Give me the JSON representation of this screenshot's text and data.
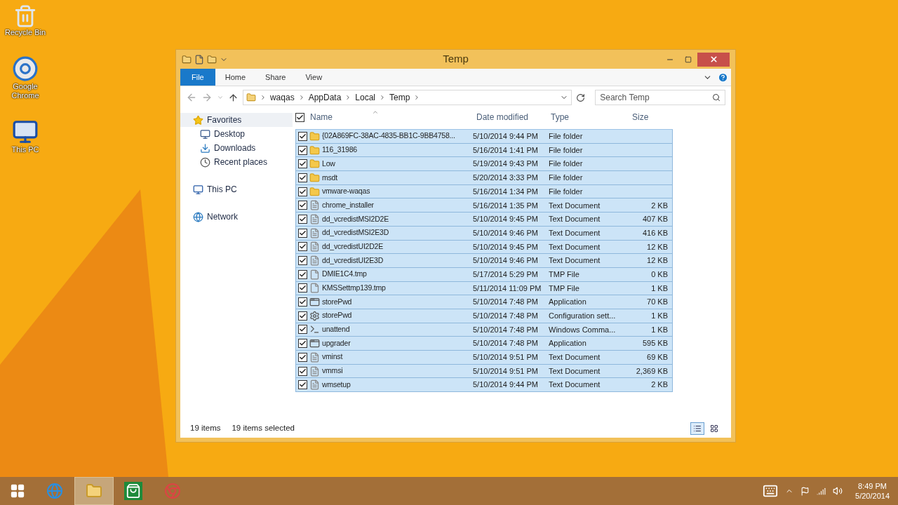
{
  "desktop_icons": [
    {
      "label": "Recycle Bin",
      "kind": "bin"
    },
    {
      "label": "Google Chrome",
      "kind": "browser"
    },
    {
      "label": "This PC",
      "kind": "pc"
    }
  ],
  "window": {
    "title": "Temp",
    "ribbon_tabs": [
      {
        "label": "File",
        "kind": "file",
        "selected": false
      },
      {
        "label": "Home",
        "kind": "tab",
        "selected": false
      },
      {
        "label": "Share",
        "kind": "tab",
        "selected": false
      },
      {
        "label": "View",
        "kind": "tab",
        "selected": false
      }
    ],
    "address": {
      "breadcrumbs": [
        "waqas",
        "AppData",
        "Local",
        "Temp"
      ]
    },
    "search": {
      "placeholder": "Search Temp"
    },
    "nav": [
      {
        "label": "Favorites",
        "kind": "star",
        "selected": true,
        "children": [
          {
            "label": "Desktop",
            "kind": "desktop",
            "selected": false
          },
          {
            "label": "Downloads",
            "kind": "downloads",
            "selected": false
          },
          {
            "label": "Recent places",
            "kind": "recent",
            "selected": false
          }
        ]
      },
      {
        "label": "This PC",
        "kind": "pc",
        "selected": false
      },
      {
        "label": "Network",
        "kind": "network",
        "selected": false
      }
    ],
    "select_all_checked": true,
    "columns": [
      {
        "label": "Name",
        "sorted": true
      },
      {
        "label": "Date modified",
        "sorted": false
      },
      {
        "label": "Type",
        "sorted": false
      },
      {
        "label": "Size",
        "sorted": false
      }
    ],
    "rows": [
      {
        "name": "{02A869FC-38AC-4835-BB1C-9BB4758...",
        "date": "5/10/2014 9:44 PM",
        "type": "File folder",
        "size": "",
        "kind": "folder",
        "selected": true
      },
      {
        "name": "116_31986",
        "date": "5/16/2014 1:41 PM",
        "type": "File folder",
        "size": "",
        "kind": "folder",
        "selected": true
      },
      {
        "name": "Low",
        "date": "5/19/2014 9:43 PM",
        "type": "File folder",
        "size": "",
        "kind": "folder",
        "selected": true
      },
      {
        "name": "msdt",
        "date": "5/20/2014 3:33 PM",
        "type": "File folder",
        "size": "",
        "kind": "folder",
        "selected": true
      },
      {
        "name": "vmware-waqas",
        "date": "5/16/2014 1:34 PM",
        "type": "File folder",
        "size": "",
        "kind": "folder",
        "selected": true
      },
      {
        "name": "chrome_installer",
        "date": "5/16/2014 1:35 PM",
        "type": "Text Document",
        "size": "2 KB",
        "kind": "text",
        "selected": true
      },
      {
        "name": "dd_vcredistMSI2D2E",
        "date": "5/10/2014 9:45 PM",
        "type": "Text Document",
        "size": "407 KB",
        "kind": "text",
        "selected": true
      },
      {
        "name": "dd_vcredistMSI2E3D",
        "date": "5/10/2014 9:46 PM",
        "type": "Text Document",
        "size": "416 KB",
        "kind": "text",
        "selected": true
      },
      {
        "name": "dd_vcredistUI2D2E",
        "date": "5/10/2014 9:45 PM",
        "type": "Text Document",
        "size": "12 KB",
        "kind": "text",
        "selected": true
      },
      {
        "name": "dd_vcredistUI2E3D",
        "date": "5/10/2014 9:46 PM",
        "type": "Text Document",
        "size": "12 KB",
        "kind": "text",
        "selected": true
      },
      {
        "name": "DMIE1C4.tmp",
        "date": "5/17/2014 5:29 PM",
        "type": "TMP File",
        "size": "0 KB",
        "kind": "blank",
        "selected": true
      },
      {
        "name": "KMSSettmp139.tmp",
        "date": "5/11/2014 11:09 PM",
        "type": "TMP File",
        "size": "1 KB",
        "kind": "blank",
        "selected": true
      },
      {
        "name": "storePwd",
        "date": "5/10/2014 7:48 PM",
        "type": "Application",
        "size": "70 KB",
        "kind": "app",
        "selected": true
      },
      {
        "name": "storePwd",
        "date": "5/10/2014 7:48 PM",
        "type": "Configuration sett...",
        "size": "1 KB",
        "kind": "config",
        "selected": true
      },
      {
        "name": "unattend",
        "date": "5/10/2014 7:48 PM",
        "type": "Windows Comma...",
        "size": "1 KB",
        "kind": "cmd",
        "selected": true
      },
      {
        "name": "upgrader",
        "date": "5/10/2014 7:48 PM",
        "type": "Application",
        "size": "595 KB",
        "kind": "app",
        "selected": true
      },
      {
        "name": "vminst",
        "date": "5/10/2014 9:51 PM",
        "type": "Text Document",
        "size": "69 KB",
        "kind": "text",
        "selected": true
      },
      {
        "name": "vmmsi",
        "date": "5/10/2014 9:51 PM",
        "type": "Text Document",
        "size": "2,369 KB",
        "kind": "text",
        "selected": true
      },
      {
        "name": "wmsetup",
        "date": "5/10/2014 9:44 PM",
        "type": "Text Document",
        "size": "2 KB",
        "kind": "text",
        "selected": true
      }
    ],
    "status_bar": {
      "items": "19 items",
      "selected": "19 items selected"
    }
  },
  "taskbar": {
    "apps": [
      {
        "kind": "ie",
        "active": false
      },
      {
        "kind": "explorer",
        "active": true
      },
      {
        "kind": "store",
        "active": false
      },
      {
        "kind": "chrome",
        "active": false
      }
    ],
    "time": "8:49 PM",
    "date": "5/20/2014"
  }
}
